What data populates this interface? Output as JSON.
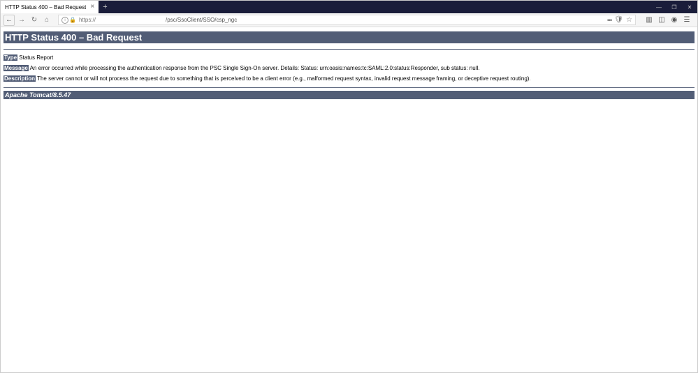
{
  "tab": {
    "title": "HTTP Status 400 – Bad Request"
  },
  "url": {
    "protocol": "https://",
    "path": "/psc/SsoClient/SSO/csp_ngc"
  },
  "page": {
    "heading": "HTTP Status 400 – Bad Request",
    "type_label": "Type",
    "type_value": " Status Report",
    "msg_label": "Message",
    "msg_value": " An error occurred while processing the authentication response from the PSC Single Sign-On server. Details: Status: urn:oasis:names:tc:SAML:2.0:status:Responder, sub status: null.",
    "desc_label": "Description",
    "desc_value": " The server cannot or will not process the request due to something that is perceived to be a client error (e.g., malformed request syntax, invalid request message framing, or deceptive request routing).",
    "server": "Apache Tomcat/8.5.47"
  }
}
